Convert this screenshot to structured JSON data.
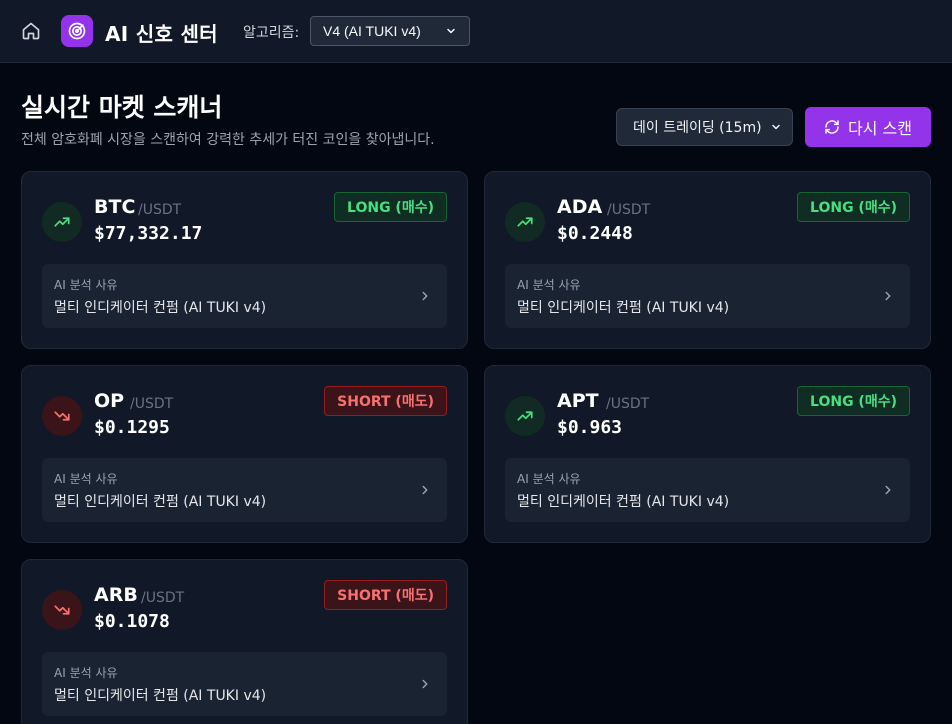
{
  "header": {
    "app_title": "AI 신호 센터",
    "algorithm_label": "알고리즘:",
    "algorithm_value": "V4 (AI TUKI v4)"
  },
  "page": {
    "title": "실시간 마켓 스캐너",
    "subtitle": "전체 암호화폐 시장을 스캔하여 강력한 추세가 터진 코인을 찾아냅니다.",
    "mode_value": "데이 트레이딩 (15m)",
    "rescan_label": "다시 스캔"
  },
  "colors": {
    "accent": "#9333ea",
    "long": "#4ade80",
    "short": "#f87171"
  },
  "cards": [
    {
      "symbol": "BTC",
      "quote": "/USDT",
      "price": "$77,332.17",
      "signal": "LONG (매수)",
      "direction": "up",
      "reason_label": "AI 분석 사유",
      "reason": "멀티 인디케이터 컨펌 (AI TUKI v4)"
    },
    {
      "symbol": "ADA",
      "quote": "/USDT",
      "price": "$0.2448",
      "signal": "LONG (매수)",
      "direction": "up",
      "reason_label": "AI 분석 사유",
      "reason": "멀티 인디케이터 컨펌 (AI TUKI v4)"
    },
    {
      "symbol": "OP",
      "quote": "/USDT",
      "price": "$0.1295",
      "signal": "SHORT (매도)",
      "direction": "down",
      "reason_label": "AI 분석 사유",
      "reason": "멀티 인디케이터 컨펌 (AI TUKI v4)"
    },
    {
      "symbol": "APT",
      "quote": "/USDT",
      "price": "$0.963",
      "signal": "LONG (매수)",
      "direction": "up",
      "reason_label": "AI 분석 사유",
      "reason": "멀티 인디케이터 컨펌 (AI TUKI v4)"
    },
    {
      "symbol": "ARB",
      "quote": "/USDT",
      "price": "$0.1078",
      "signal": "SHORT (매도)",
      "direction": "down",
      "reason_label": "AI 분석 사유",
      "reason": "멀티 인디케이터 컨펌 (AI TUKI v4)"
    }
  ]
}
